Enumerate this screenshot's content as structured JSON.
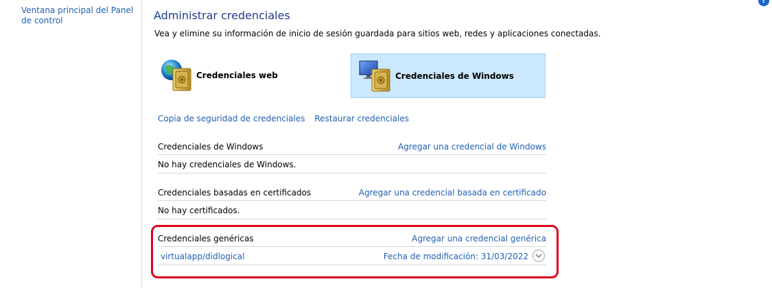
{
  "sidebar": {
    "home_link": "Ventana principal del Panel de control"
  },
  "header": {
    "title": "Administrar credenciales",
    "description": "Vea y elimine su información de inicio de sesión guardada para sitios web, redes y aplicaciones conectadas."
  },
  "vaults": [
    {
      "label": "Credenciales web",
      "icon": "web-credentials-icon",
      "selected": false
    },
    {
      "label": "Credenciales de Windows",
      "icon": "windows-credentials-icon",
      "selected": true
    }
  ],
  "actions": {
    "backup": "Copia de seguridad de credenciales",
    "restore": "Restaurar credenciales"
  },
  "sections": {
    "windows": {
      "title": "Credenciales de Windows",
      "add_label": "Agregar una credencial de Windows",
      "empty_text": "No hay credenciales de Windows."
    },
    "certificate": {
      "title": "Credenciales basadas en certificados",
      "add_label": "Agregar una credencial basada en certificado",
      "empty_text": "No hay certificados."
    },
    "generic": {
      "title": "Credenciales genéricas",
      "add_label": "Agregar una credencial genérica",
      "items": [
        {
          "name": "virtualapp/didlogical",
          "modified": "Fecha de modificación:  31/03/2022"
        }
      ]
    }
  },
  "colors": {
    "link": "#1e5fb3",
    "title": "#1e3c8a",
    "selected_tile": "#cce8ff",
    "highlight": "#e0001a"
  },
  "help": {
    "glyph": "?"
  }
}
